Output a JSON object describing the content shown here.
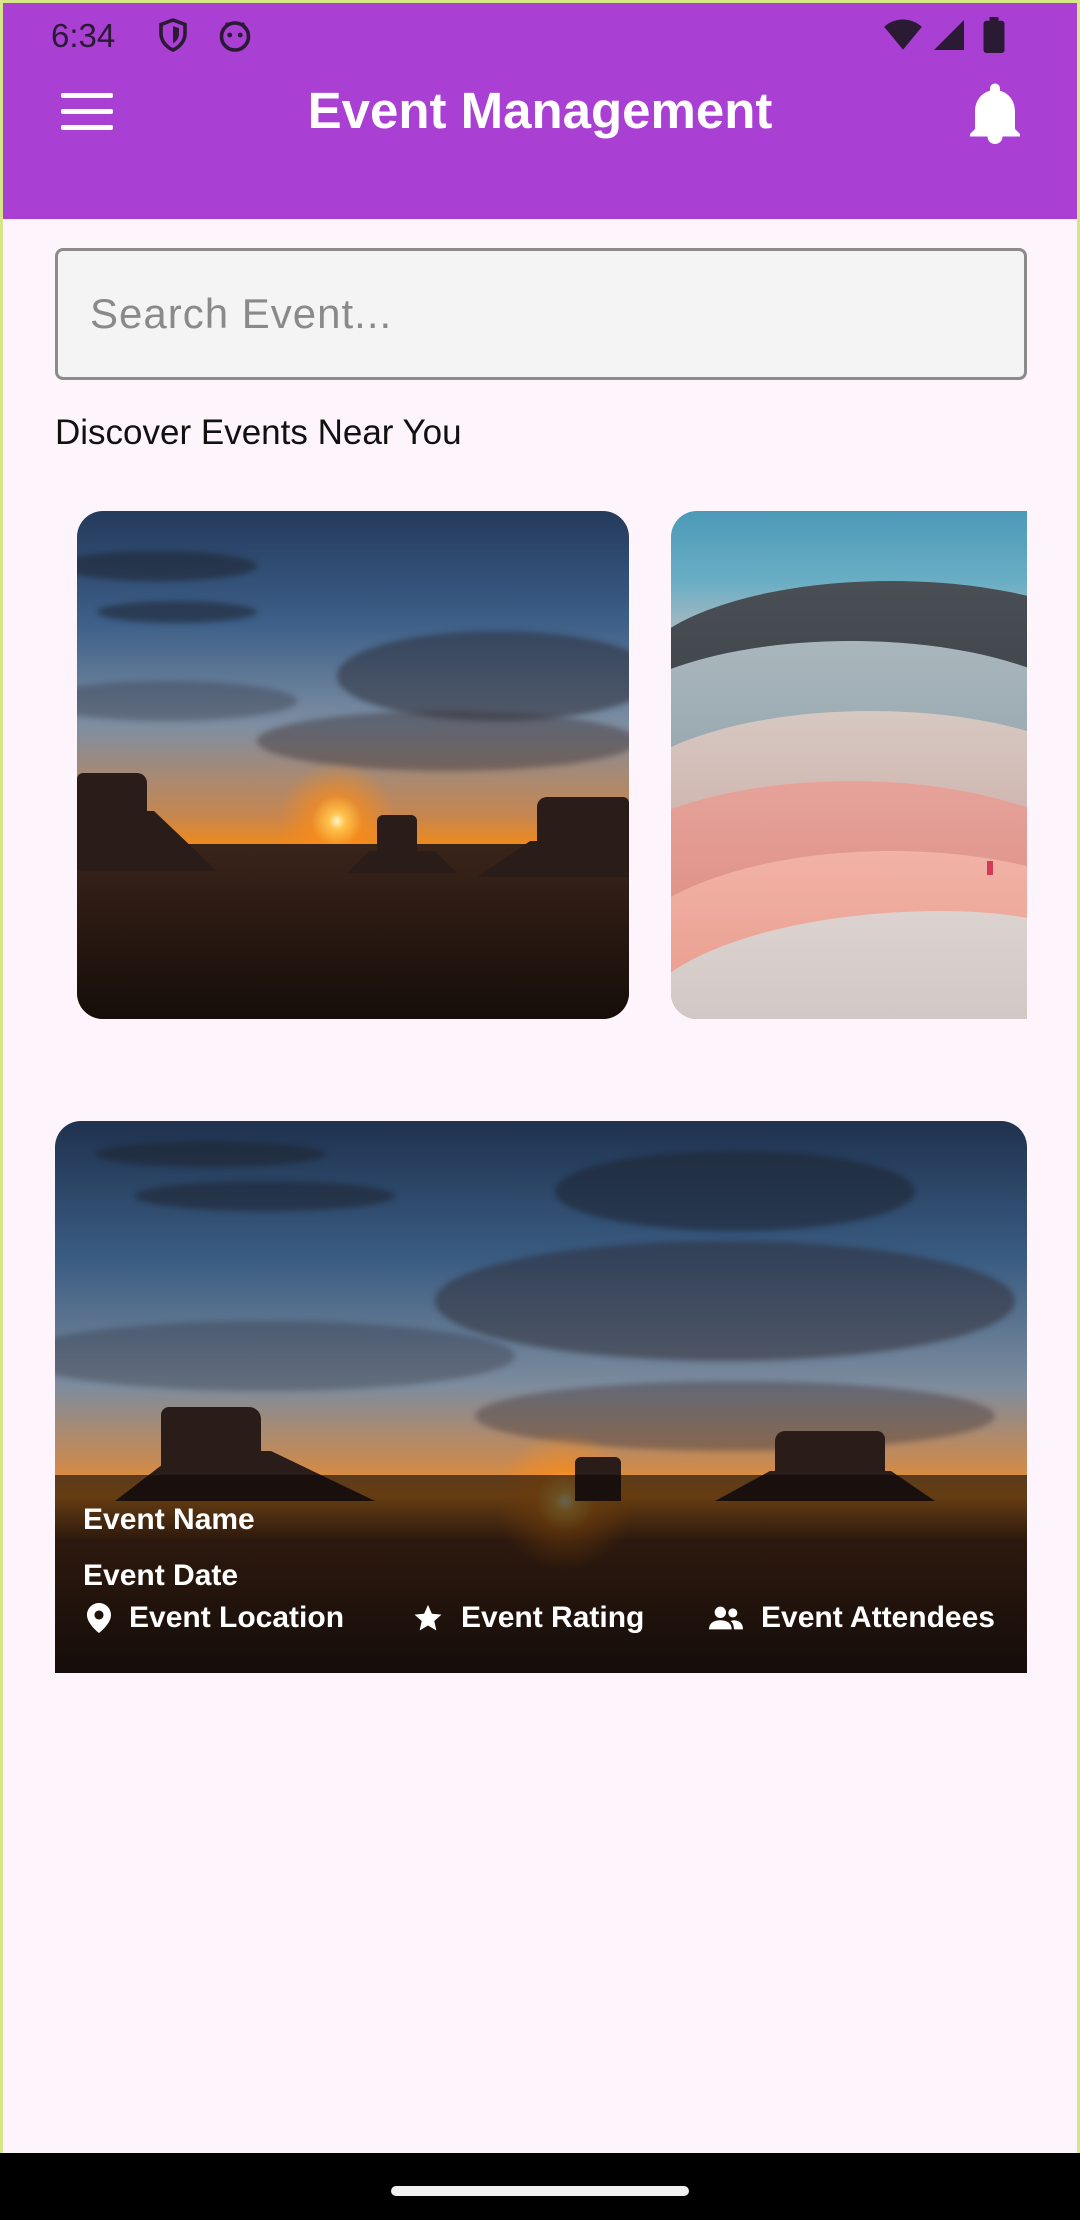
{
  "status_bar": {
    "time": "6:34"
  },
  "app_bar": {
    "title": "Event Management"
  },
  "search": {
    "placeholder": "Search Event..."
  },
  "discover": {
    "title": "Discover Events Near You"
  },
  "featured_event": {
    "name": "Event Name",
    "date": "Event Date",
    "location": "Event Location",
    "rating": "Event Rating",
    "attendees": "Event Attendees"
  },
  "icons": {
    "menu": "menu-icon",
    "notifications": "bell-icon",
    "location": "location-pin-icon",
    "rating": "star-icon",
    "attendees": "people-icon"
  },
  "colors": {
    "app_bar": "#a93fd3",
    "background": "#fdf5fb",
    "on_primary": "#ffffff"
  }
}
